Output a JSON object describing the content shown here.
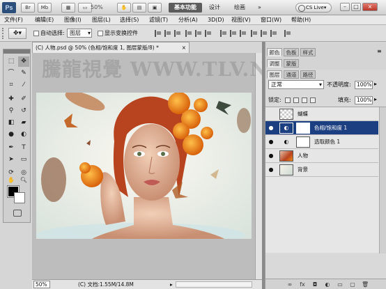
{
  "app": {
    "logo": "Ps",
    "workspaces": [
      "基本功能",
      "设计",
      "绘画"
    ],
    "active_workspace": "基本功能",
    "zoom_label": "50%",
    "cs_live": "CS Live▾",
    "window_buttons": [
      "–",
      "□",
      "×"
    ]
  },
  "menu": [
    "文件(F)",
    "编辑(E)",
    "图像(I)",
    "图层(L)",
    "选择(S)",
    "滤镜(T)",
    "分析(A)",
    "3D(D)",
    "视图(V)",
    "窗口(W)",
    "帮助(H)"
  ],
  "options": {
    "auto_select_label": "自动选择:",
    "auto_select_value": "图层",
    "show_transform_label": "显示变换控件"
  },
  "document": {
    "tab_title": "(C) 人物.psd @ 50% (色相/饱和度 1, 图层蒙版/8) *",
    "tab_close": "×",
    "zoom": "50%",
    "info": "(C) 文档:1.55M/14.8M",
    "watermark": "騰龍視覺 WWW.TLV.NET"
  },
  "panels": {
    "top_tabs": [
      "颜色",
      "色板",
      "样式"
    ],
    "mid_tabs": [
      "调整",
      "蒙版"
    ],
    "layer_tabs": [
      "图层",
      "通道",
      "路径"
    ],
    "blend_mode": "正常",
    "opacity_label": "不透明度:",
    "opacity_value": "100%",
    "lock_label": "锁定:",
    "fill_label": "填充:",
    "fill_value": "100%"
  },
  "layers": [
    {
      "name": "蝴蝶",
      "selected": false,
      "type": "pixel"
    },
    {
      "name": "色相/饱和度 1",
      "selected": true,
      "type": "adjustment"
    },
    {
      "name": "选取颜色 1",
      "selected": false,
      "type": "adjustment"
    },
    {
      "name": "人物",
      "selected": false,
      "type": "photo"
    },
    {
      "name": "背景",
      "selected": false,
      "type": "photo"
    }
  ],
  "colors": {
    "selected_layer": "#1c3f82",
    "hair": "#b8431f",
    "flowers": "#f08a1c"
  }
}
